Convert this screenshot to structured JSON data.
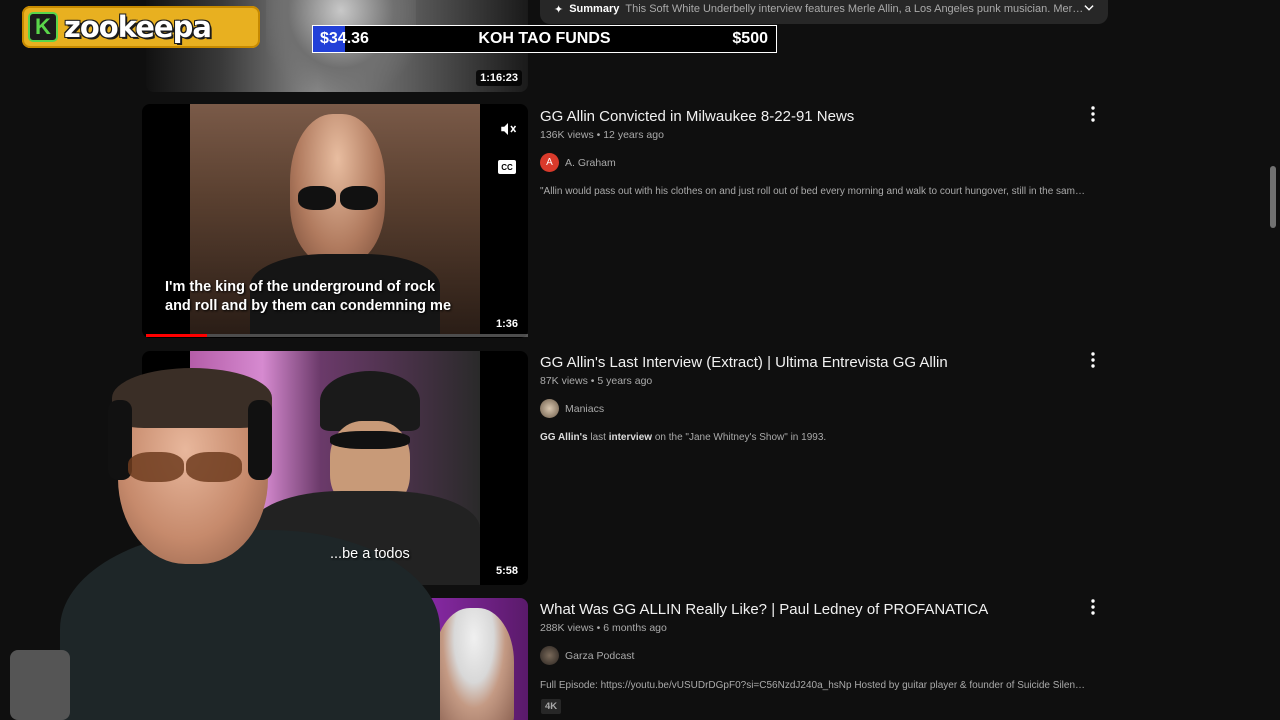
{
  "overlay": {
    "logo_letter": "K",
    "logo_text": "zookeepa",
    "fund": {
      "current": "$34.36",
      "name": "KOH TAO FUNDS",
      "goal": "$500",
      "progress": 0.069
    }
  },
  "top_result": {
    "duration": "1:16:23",
    "summary_label": "Summary",
    "summary_text": "This Soft White Underbelly interview features Merle Allin, a Los Angeles punk musician. Merle discusses their..."
  },
  "videos": [
    {
      "title": "GG Allin Convicted in Milwaukee 8-22-91 News",
      "views": "136K views",
      "age": "12 years ago",
      "channel": "A. Graham",
      "channel_initial": "A",
      "description": "\"Allin would pass out with his clothes on and just roll out of bed every morning and walk to court hungover, still in the same clothes ...",
      "duration": "1:36",
      "caption_line1": "I'm the king of the underground of rock",
      "caption_line2": "and roll and by them can condemning me",
      "progress": 0.16
    },
    {
      "title": "GG Allin's Last Interview (Extract) | Ultima Entrevista GG Allin",
      "views": "87K views",
      "age": "5 years ago",
      "channel": "Maniacs",
      "description_bold": "GG Allin's",
      "description_mid": " last ",
      "description_bold2": "interview",
      "description_rest": " on the \"Jane Whitney's Show\" in 1993.",
      "duration": "5:58",
      "caption": "...be a todos"
    },
    {
      "title": "What Was GG ALLIN Really Like? | Paul Ledney of PROFANATICA",
      "views": "288K views",
      "age": "6 months ago",
      "channel": "Garza Podcast",
      "description": "Full Episode: https://youtu.be/vUSUDrDGpF0?si=C56NzdJ240a_hsNp Hosted by guitar player & founder of Suicide Silence, Chris ...",
      "badge": "4K"
    }
  ],
  "icons": {
    "mute": "mute-icon",
    "cc": "CC",
    "more": "more-vert-icon",
    "chevron": "chevron-down-icon",
    "spark": "✦"
  },
  "colors": {
    "bg": "#0f0f0f",
    "accent_red": "#ff0000",
    "fund_fill": "#2240d8",
    "logo_bg": "#e8b020"
  }
}
